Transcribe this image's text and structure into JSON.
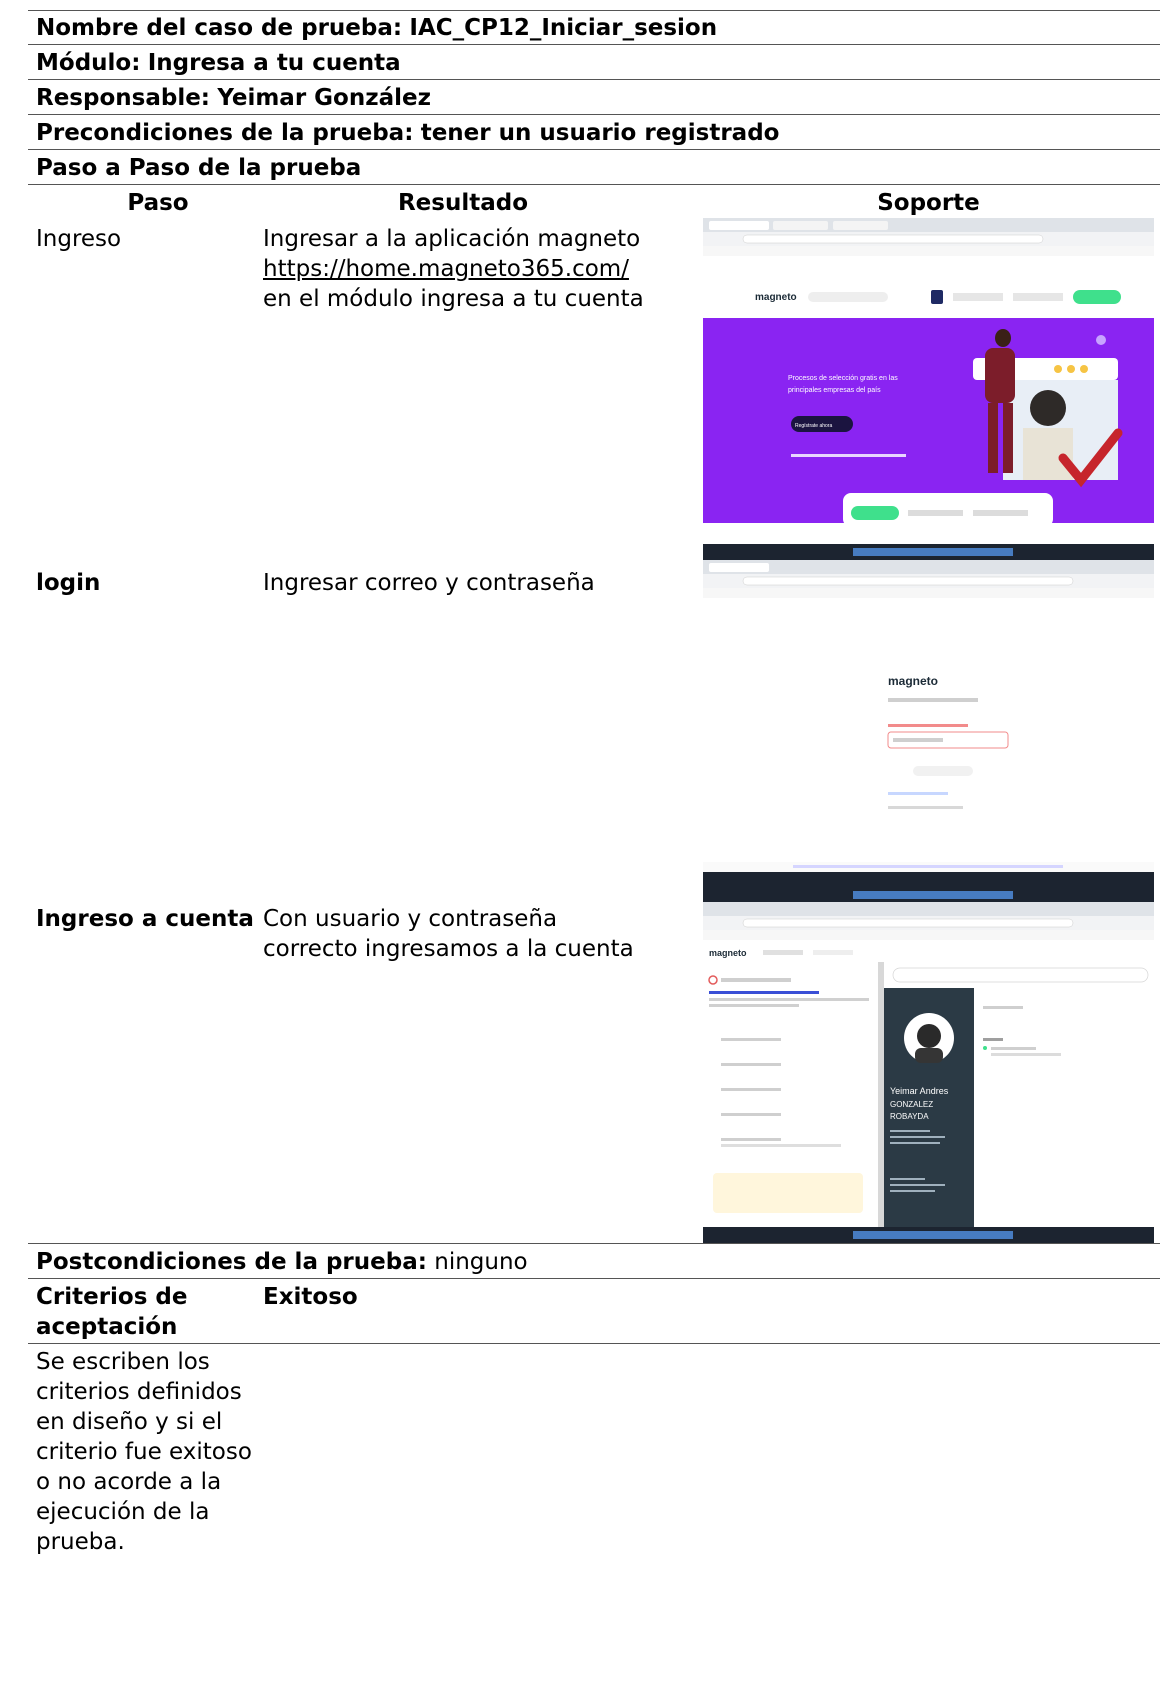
{
  "header": {
    "test_name_label": "Nombre del caso de prueba:",
    "test_name_value": "IAC_CP12_Iniciar_sesion",
    "module_label": "Módulo:",
    "module_value": "Ingresa a tu cuenta",
    "owner_label": "Responsable:",
    "owner_value": "Yeimar González",
    "preconditions_label": "Precondiciones de la prueba:",
    "preconditions_value": "tener un usuario registrado",
    "steps_title": "Paso a Paso de la prueba"
  },
  "columns": {
    "step": "Paso",
    "result": "Resultado",
    "support": "Soporte"
  },
  "steps": [
    {
      "name": "Ingreso",
      "result_line1": "Ingresar a la aplicación magneto",
      "result_link": "https://home.magneto365.com/",
      "result_line3": "en el módulo ingresa a tu cuenta",
      "screenshot": "magneto-home-screenshot"
    },
    {
      "name": "login",
      "result_line1": "Ingresar correo y contraseña",
      "screenshot": "magneto-login-screenshot"
    },
    {
      "name": "Ingreso a cuenta",
      "result_line1": "Con usuario y contraseña",
      "result_line2": "correcto ingresamos a la cuenta",
      "screenshot": "magneto-profile-screenshot"
    }
  ],
  "postconditions": {
    "label": "Postcondiciones de la prueba:",
    "value": "ninguno"
  },
  "acceptance": {
    "label_line1": "Criterios de",
    "label_line2": "aceptación",
    "status": "Exitoso",
    "description_lines": [
      "Se escriben los",
      "criterios definidos",
      "en diseño y si el",
      "criterio fue exitoso",
      "o no acorde a la",
      "ejecución de la",
      "prueba."
    ]
  },
  "screens": {
    "brand": "magneto",
    "hero_text_1": "Procesos de selección gratis en las",
    "hero_text_2": "principales empresas del país",
    "hero_button": "Regístrate ahora",
    "profile_name_1": "Yeimar Andres",
    "profile_name_2": "GONZALEZ",
    "profile_name_3": "ROBAYDA",
    "colors": {
      "brand_purple": "#8a24f2",
      "accent_green": "#3fe08c",
      "dark_panel": "#2b3a45",
      "taskbar": "#1c2430"
    }
  }
}
